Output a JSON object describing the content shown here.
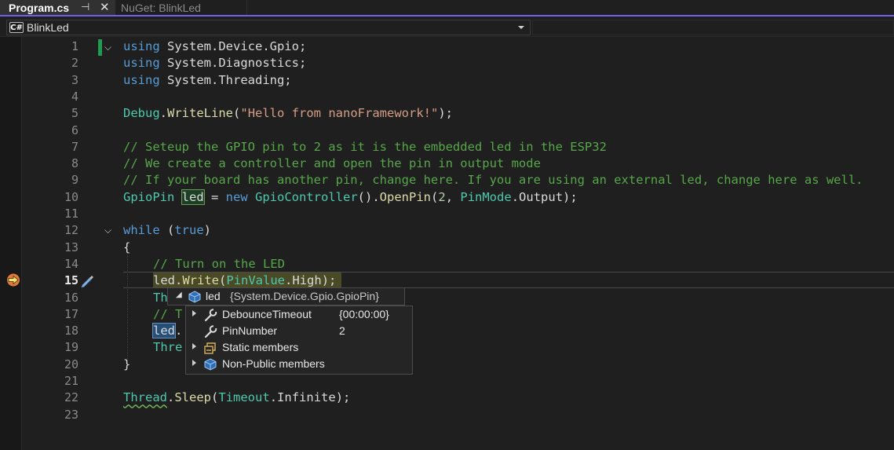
{
  "tabs": [
    {
      "label": "Program.cs",
      "pin_icon": "⊣",
      "close_icon": "✕",
      "active": true
    },
    {
      "label": "NuGet: BlinkLed",
      "active": false
    }
  ],
  "navbar": {
    "project": "BlinkLed",
    "lang_badge": "C#"
  },
  "line_numbers": [
    "1",
    "2",
    "3",
    "4",
    "5",
    "6",
    "7",
    "8",
    "9",
    "10",
    "11",
    "12",
    "13",
    "14",
    "15",
    "16",
    "17",
    "18",
    "19",
    "20",
    "21",
    "22",
    "23"
  ],
  "current_line": "15",
  "code": {
    "l1": {
      "kw": "using",
      "rest": " System.Device.Gpio;"
    },
    "l2": {
      "kw": "using",
      "rest": " System.Diagnostics;"
    },
    "l3": {
      "kw": "using",
      "rest": " System.Threading;"
    },
    "l5": {
      "type": "Debug",
      "dot": ".",
      "method": "WriteLine",
      "open": "(",
      "str": "\"Hello from nanoFramework!\"",
      "close": ");"
    },
    "l7": "// Seteup the GPIO pin to 2 as it is the embedded led in the ESP32",
    "l8": "// We create a controller and open the pin in output mode",
    "l9": "// If your board has another pin, change here. If you are using an external led, change here as well.",
    "l10": {
      "type1": "GpioPin",
      "var": "led",
      "eq": " = ",
      "new": "new",
      "type2": "GpioController",
      "p1": "().",
      "method": "OpenPin",
      "p2": "(",
      "num": "2",
      "p3": ", ",
      "type3": "PinMode",
      "dot": ".",
      "member": "Output",
      "end": ");"
    },
    "l12": {
      "kw": "while",
      "p1": " (",
      "val": "true",
      "p2": ")"
    },
    "l13": "{",
    "l14": "// Turn on the LED",
    "l15": {
      "var": "led",
      "dot": ".",
      "method": "Write",
      "p1": "(",
      "type": "PinValue",
      "dot2": ".",
      "member": "High",
      "p2": ");"
    },
    "l16": "Thr",
    "l17": "// T",
    "l18": {
      "var": "led",
      "rest": "."
    },
    "l19": "Thre",
    "l20": "}",
    "l22": {
      "type": "Thread",
      "dot": ".",
      "method": "Sleep",
      "p1": "(",
      "type2": "Timeout",
      "dot2": ".",
      "member": "Infinite",
      "p2": ");"
    }
  },
  "datatip": {
    "header": {
      "name": "led",
      "value": "{System.Device.Gpio.GpioPin}"
    },
    "rows": [
      {
        "name": "DebounceTimeout",
        "value": "{00:00:00}",
        "icon": "wrench-icon"
      },
      {
        "name": "PinNumber",
        "value": "2",
        "icon": "wrench-icon"
      },
      {
        "name": "Static members",
        "value": "",
        "icon": "static-members-icon"
      },
      {
        "name": "Non-Public members",
        "value": "",
        "icon": "object-icon"
      }
    ]
  },
  "colors": {
    "accent": "#7160e8",
    "keyword": "#569cd6",
    "type": "#4ec9b0",
    "method": "#dcdcaa",
    "string": "#d69d85",
    "comment": "#57a64a"
  }
}
